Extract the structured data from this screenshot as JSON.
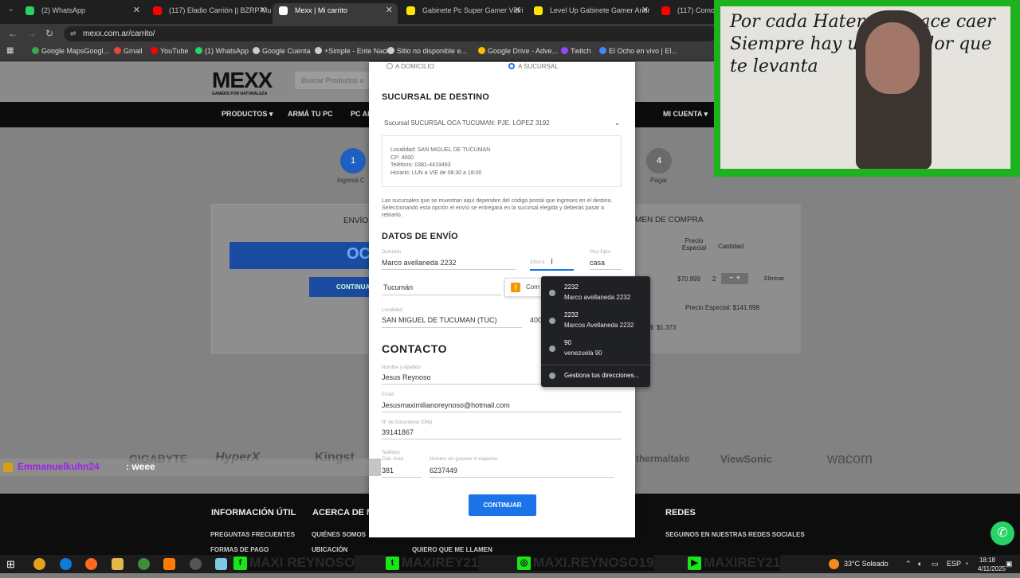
{
  "browser": {
    "tabs": [
      {
        "label": "(2) WhatsApp",
        "color": "#25d366"
      },
      {
        "label": "(117) Eladio Carrión || BZRP Mu",
        "color": "#ff0000"
      },
      {
        "label": "Mexx | Mi carrito",
        "color": "#ffffff"
      },
      {
        "label": "Gabinete Pc Super Gamer Vidri",
        "color": "#ffe600"
      },
      {
        "label": "Level Up Gabinete Gamer Andr",
        "color": "#ffe600"
      },
      {
        "label": "(117) Como arm",
        "color": "#ff0000"
      }
    ],
    "url": "mexx.com.ar/carrito/",
    "bookmarks": [
      {
        "label": "Google MapsGoogl...",
        "color": "#34a853"
      },
      {
        "label": "Gmail",
        "color": "#ea4335"
      },
      {
        "label": "YouTube",
        "color": "#ff0000"
      },
      {
        "label": "(1) WhatsApp",
        "color": "#25d366"
      },
      {
        "label": "Google Cuenta",
        "color": "#cccccc"
      },
      {
        "label": "+Simple - Ente Naci...",
        "color": "#cccccc"
      },
      {
        "label": "Sitio no disponible e...",
        "color": "#cccccc"
      },
      {
        "label": "Google Drive - Adve...",
        "color": "#fbbc04"
      },
      {
        "label": "Twitch",
        "color": "#9146ff"
      },
      {
        "label": "El Ocho en vivo | El...",
        "color": "#4285f4"
      }
    ]
  },
  "site": {
    "logo": "MEXX",
    "logo_tagline": "GAMERS POR NATURALEZA",
    "search_placeholder": "Buscar Productos o",
    "nav": [
      "PRODUCTOS ▾",
      "ARMÁ TU PC",
      "PC AR",
      "MI CUENTA ▾"
    ],
    "steps": [
      {
        "num": "1",
        "label": "Ingresá C"
      },
      {
        "num": "4",
        "label": "Pagar"
      }
    ],
    "left_card": {
      "title": "ENVÍO",
      "button_text": "OC",
      "button2": "CONTINUA"
    },
    "summary": {
      "title": "MEN DE COMPRA",
      "col1": "Precio Especial",
      "col2": "Cantidad",
      "price": "$70.999",
      "qty": "2",
      "remove": "Eliminar",
      "special_price": "Precio Especial: $141.998",
      "total_partial": "$: $1.373"
    },
    "brands": [
      "GIGABYTE",
      "HyperX",
      "Kingst",
      "thermaltake",
      "ViewSonic",
      "wacom"
    ],
    "footer": {
      "col1_title": "INFORMACIÓN ÚTIL",
      "col1_items": [
        "PREGUNTAS FRECUENTES",
        "FORMAS DE PAGO"
      ],
      "col2_title": "ACERCA DE M",
      "col2_items": [
        "QUIÉNES SOMOS",
        "UBICACIÓN"
      ],
      "col3_item": "QUIERO QUE ME LLAMEN",
      "col4_title": "REDES",
      "col4_items": [
        "SEGUINOS EN NUESTRAS REDES SOCIALES"
      ]
    }
  },
  "modal": {
    "radio1": "A DOMICILIO",
    "radio2": "A SUCURSAL",
    "destino_title": "SUCURSAL DE DESTINO",
    "destino_select": "Sucursal SUCURSAL OCA TUCUMAN: PJE. LÓPEZ 3192",
    "destino_info": [
      "Localidad: SAN MIGUEL DE TUCUMAN",
      "CP: 4000",
      "Teléfono: 0381-4419493",
      "Horario: LUN a VIE de 08:30 a 18:00"
    ],
    "destino_note": "Las sucursales que se muestran aquí dependen del código postal que ingreses en el destino. Seleccionando esta opción el envío se entregará en la sucursal elegida y deberás pasar a retirarlo.",
    "envio_title": "DATOS DE ENVÍO",
    "domicilio_label": "Domicilio",
    "domicilio_value": "Marco avellaneda 2232",
    "altura_placeholder": "Altura",
    "piso_label": "Piso Dpto",
    "piso_value": "casa",
    "provincia_value": "Tucumán",
    "localidad_label": "Localidad",
    "localidad_value": "SAN MIGUEL DE TUCUMAN (TUC)",
    "cp_partial": "400",
    "warn_text": "Com",
    "contacto_title": "CONTACTO",
    "nombre_label": "Nombre y Apellido",
    "nombre_value": "Jesus Reynoso",
    "email_label": "Email",
    "email_value": "Jesusmaximilianoreynoso@hotmail.com",
    "dni_label": "N° de Documento (DNI)",
    "dni_value": "39141867",
    "tel_label": "Teléfono",
    "cod_area_label": "Cód. Área",
    "cod_area_value": "381",
    "numero_label": "Número sin guiones ni espacios",
    "numero_value": "6237449",
    "continuar": "CONTINUAR"
  },
  "autofill": {
    "items": [
      {
        "title": "2232",
        "sub": "Marco avellaneda 2232"
      },
      {
        "title": "2232",
        "sub": "Marcos Avellaneda 2232"
      },
      {
        "title": "90",
        "sub": "venezuela 90"
      }
    ],
    "manage": "Gestiona tus direcciones..."
  },
  "stream": {
    "cam_text": "Por cada Hater que hace caer Siempre hay un seguidor que te levanta",
    "chat_user": "Emmanuelkuhn24",
    "chat_msg": ": weee",
    "socials": [
      {
        "icon": "f",
        "label": "MAXI REYNOSO"
      },
      {
        "icon": "t",
        "label": "MAXIREY21"
      },
      {
        "icon": "◎",
        "label": "MAXI.REYNOSO19"
      },
      {
        "icon": "▶",
        "label": "MAXIREY21"
      }
    ]
  },
  "taskbar": {
    "weather": "33°C Soleado",
    "lang": "ESP",
    "time": "18:18",
    "date": "4/11/2025"
  }
}
